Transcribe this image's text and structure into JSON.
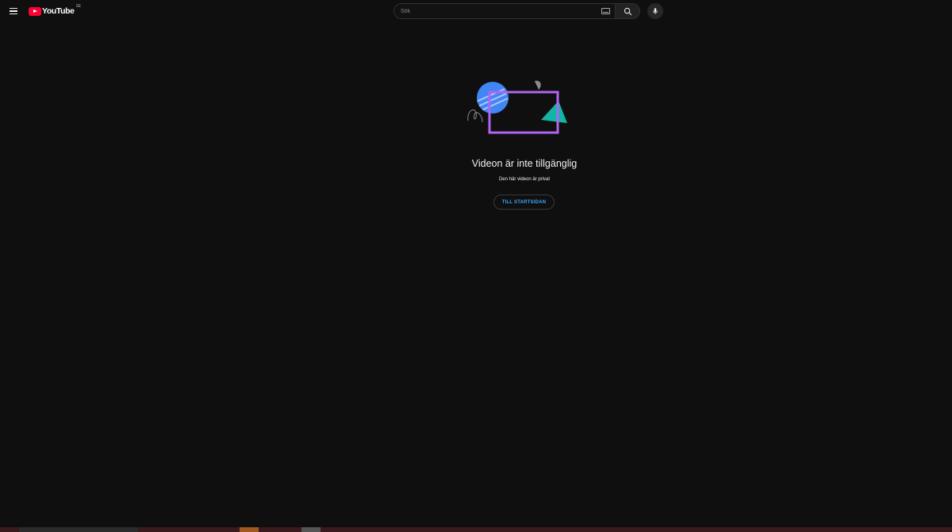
{
  "header": {
    "logo_text": "YouTube",
    "country_code": "SE",
    "search_placeholder": "Sök",
    "icons": {
      "menu": "hamburger-menu-icon",
      "keyboard": "keyboard-icon",
      "search": "search-icon",
      "mic": "microphone-icon"
    }
  },
  "main": {
    "title": "Videon är inte tillgänglig",
    "subtitle": "Den här videon är privat",
    "home_button_label": "TILL STARTSIDAN"
  },
  "colors": {
    "background": "#0f0f0f",
    "brand_red": "#ff0033",
    "link_blue": "#3ea6ff",
    "illustration_blue": "#4285f4",
    "illustration_purple": "#b065f0",
    "illustration_teal": "#13b5a6"
  }
}
